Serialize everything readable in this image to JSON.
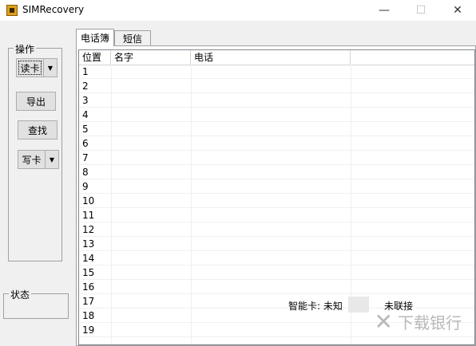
{
  "window": {
    "title": "SIMRecovery",
    "minimize": "—",
    "maximize": "☐",
    "close": "✕"
  },
  "ops": {
    "title": "操作",
    "read_card": "读卡",
    "export": "导出",
    "find": "查找",
    "write_card": "写卡",
    "arrow": "▼"
  },
  "status_group": {
    "title": "状态"
  },
  "tabs": [
    "电话簿",
    "短信"
  ],
  "table": {
    "headers": [
      "位置",
      "名字",
      "电话"
    ],
    "rows": [
      "1",
      "2",
      "3",
      "4",
      "5",
      "6",
      "7",
      "8",
      "9",
      "10",
      "11",
      "12",
      "13",
      "14",
      "15",
      "16",
      "17",
      "18",
      "19"
    ]
  },
  "statusbar": {
    "smartcard": "智能卡: 未知",
    "connection": "未联接"
  },
  "watermark": {
    "text": "下载银行"
  }
}
